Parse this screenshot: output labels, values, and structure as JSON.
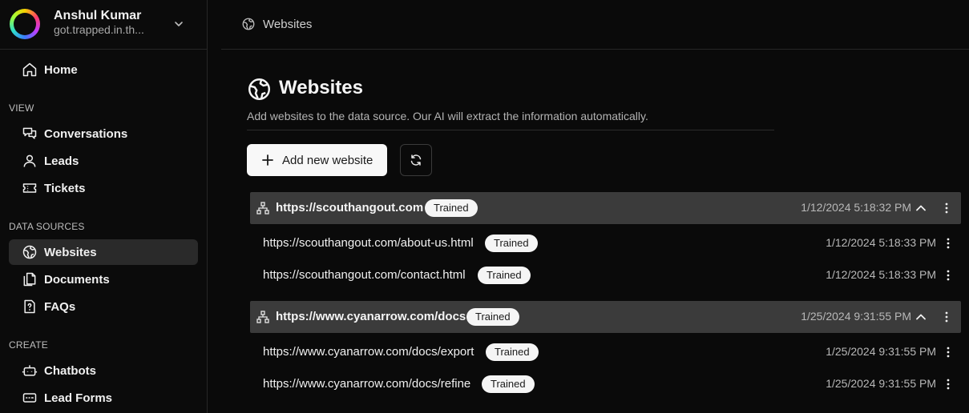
{
  "profile": {
    "name": "Anshul Kumar",
    "email": "got.trapped.in.th..."
  },
  "nav": {
    "home": "Home",
    "sections": [
      {
        "title": "VIEW",
        "items": [
          "Conversations",
          "Leads",
          "Tickets"
        ]
      },
      {
        "title": "DATA SOURCES",
        "items": [
          "Websites",
          "Documents",
          "FAQs"
        ]
      },
      {
        "title": "CREATE",
        "items": [
          "Chatbots",
          "Lead Forms"
        ]
      }
    ],
    "active": "Websites"
  },
  "breadcrumb": {
    "label": "Websites"
  },
  "page": {
    "title": "Websites",
    "description": "Add websites to the data source. Our AI will extract the information automatically.",
    "add_button": "Add new website"
  },
  "groups": [
    {
      "url": "https://scouthangout.com",
      "status": "Trained",
      "timestamp": "1/12/2024 5:18:32 PM",
      "pages": [
        {
          "url": "https://scouthangout.com/about-us.html",
          "status": "Trained",
          "timestamp": "1/12/2024 5:18:33 PM"
        },
        {
          "url": "https://scouthangout.com/contact.html",
          "status": "Trained",
          "timestamp": "1/12/2024 5:18:33 PM"
        }
      ]
    },
    {
      "url": "https://www.cyanarrow.com/docs",
      "status": "Trained",
      "timestamp": "1/25/2024 9:31:55 PM",
      "pages": [
        {
          "url": "https://www.cyanarrow.com/docs/export",
          "status": "Trained",
          "timestamp": "1/25/2024 9:31:55 PM"
        },
        {
          "url": "https://www.cyanarrow.com/docs/refine",
          "status": "Trained",
          "timestamp": "1/25/2024 9:31:55 PM"
        }
      ]
    }
  ]
}
